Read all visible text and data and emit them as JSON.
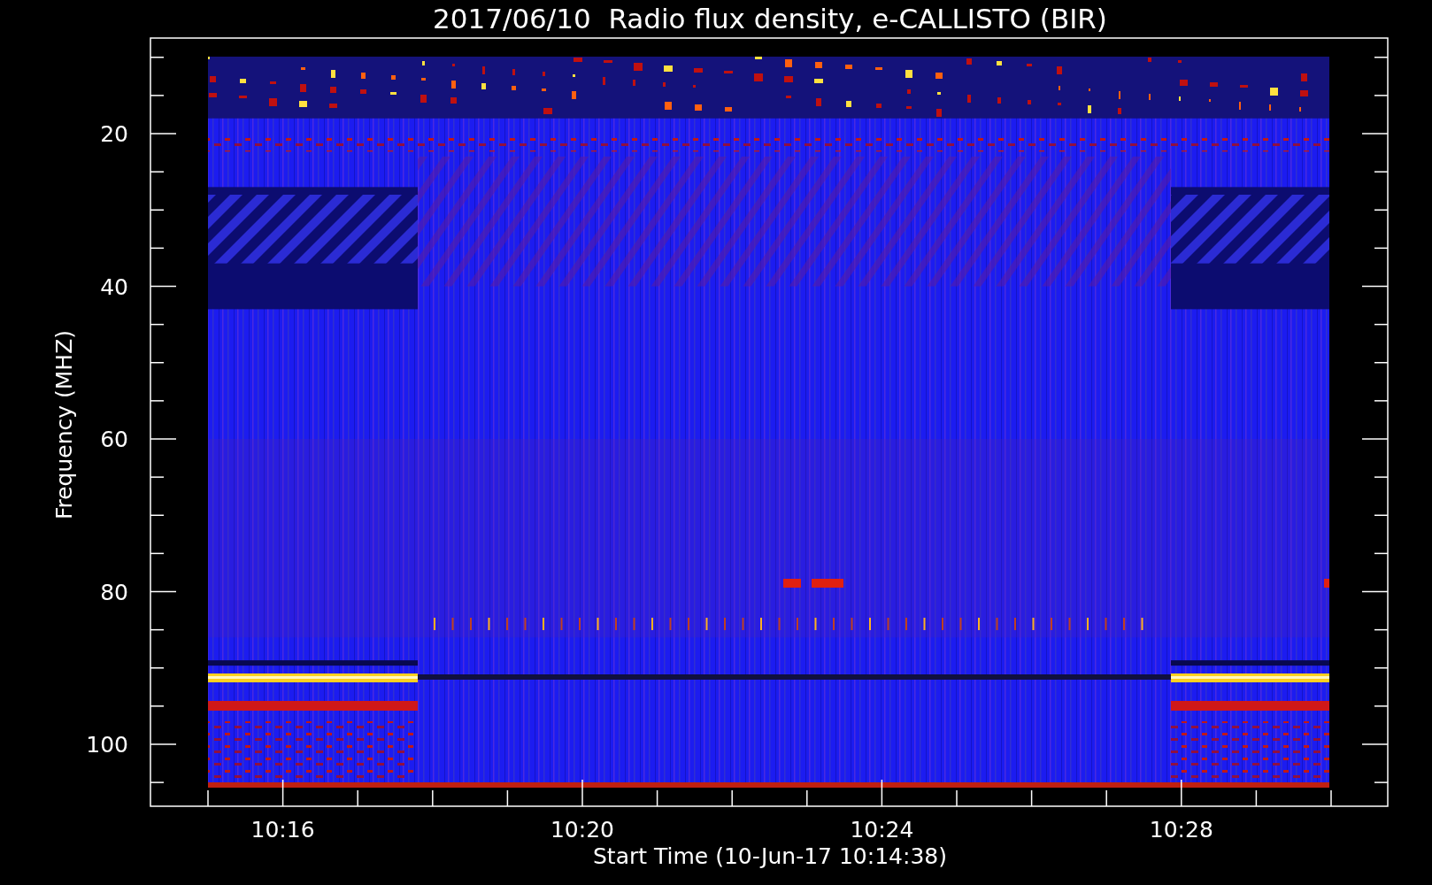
{
  "title": "2017/06/10  Radio flux density, e-CALLISTO (BIR)",
  "y_axis": {
    "label": "Frequency (MHZ)",
    "ticks": [
      "20",
      "40",
      "60",
      "80",
      "100"
    ]
  },
  "x_axis": {
    "label": "Start Time (10-Jun-17 10:14:38)",
    "ticks": [
      "10:16",
      "10:20",
      "10:24",
      "10:28"
    ]
  }
}
